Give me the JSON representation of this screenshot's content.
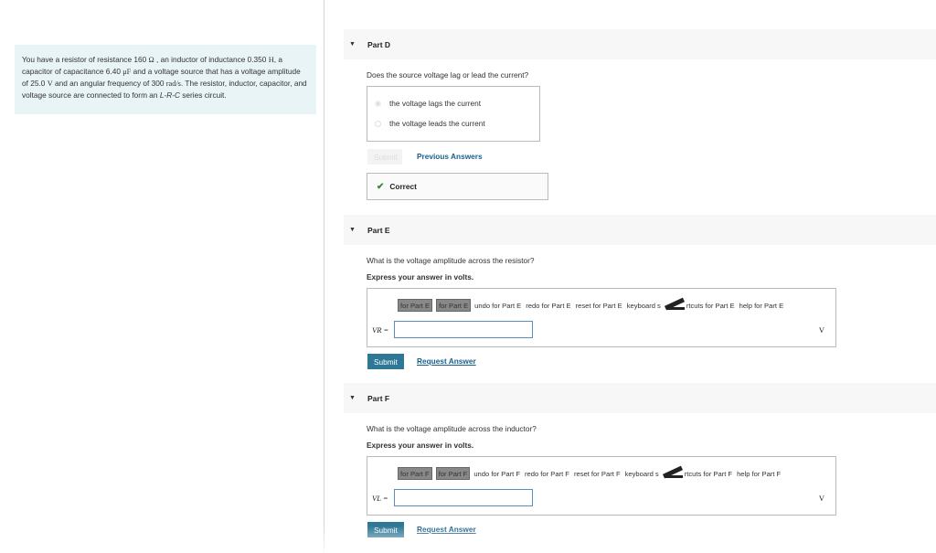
{
  "problem": {
    "text_1": "You have a resistor of resistance 160 ",
    "omega": "Ω",
    "text_2": " , an inductor of inductance 0.350 ",
    "henry": "H",
    "text_3": ", a capacitor of capacitance 6.40 ",
    "uf": "μF",
    "text_4": " and a voltage source that has a voltage amplitude of 25.0 ",
    "volt": "V",
    "text_5": " and an angular frequency of 300 ",
    "rads": "rad/s",
    "text_6": ". The resistor, inductor, capacitor, and voltage source are connected to form an ",
    "lrc": "L-R-C",
    "text_7": " series circuit."
  },
  "part_d": {
    "title": "Part D",
    "question": "Does the source voltage lag or lead the current?",
    "choices": [
      "the voltage lags the current",
      "the voltage leads the current"
    ],
    "submit_label": "Submit",
    "previous_answers_label": "Previous Answers",
    "feedback": "Correct"
  },
  "part_e": {
    "title": "Part E",
    "question": "What is the voltage amplitude across the resistor?",
    "instruction": "Express your answer in volts.",
    "toolbar": {
      "btn1": "for Part E",
      "btn2": "for Part E",
      "undo": "undo for Part E",
      "redo": "redo for Part E",
      "reset": "reset for Part E",
      "keyboard_pre": "keyboard s",
      "keyboard_post": "rtcuts for Part E",
      "help": "help for Part E"
    },
    "var_label": "VR =",
    "input_value": "",
    "unit": "V",
    "submit_label": "Submit",
    "request_label": "Request Answer"
  },
  "part_f": {
    "title": "Part F",
    "question": "What is the voltage amplitude across the inductor?",
    "instruction": "Express your answer in volts.",
    "toolbar": {
      "btn1": "for Part F",
      "btn2": "for Part F",
      "undo": "undo for Part F",
      "redo": "redo for Part F",
      "reset": "reset for Part F",
      "keyboard_pre": "keyboard s",
      "keyboard_post": "rtcuts for Part F",
      "help": "help for Part F"
    },
    "var_label": "VL =",
    "input_value": "",
    "unit": "V",
    "submit_label": "Submit",
    "request_label": "Request Answer"
  }
}
